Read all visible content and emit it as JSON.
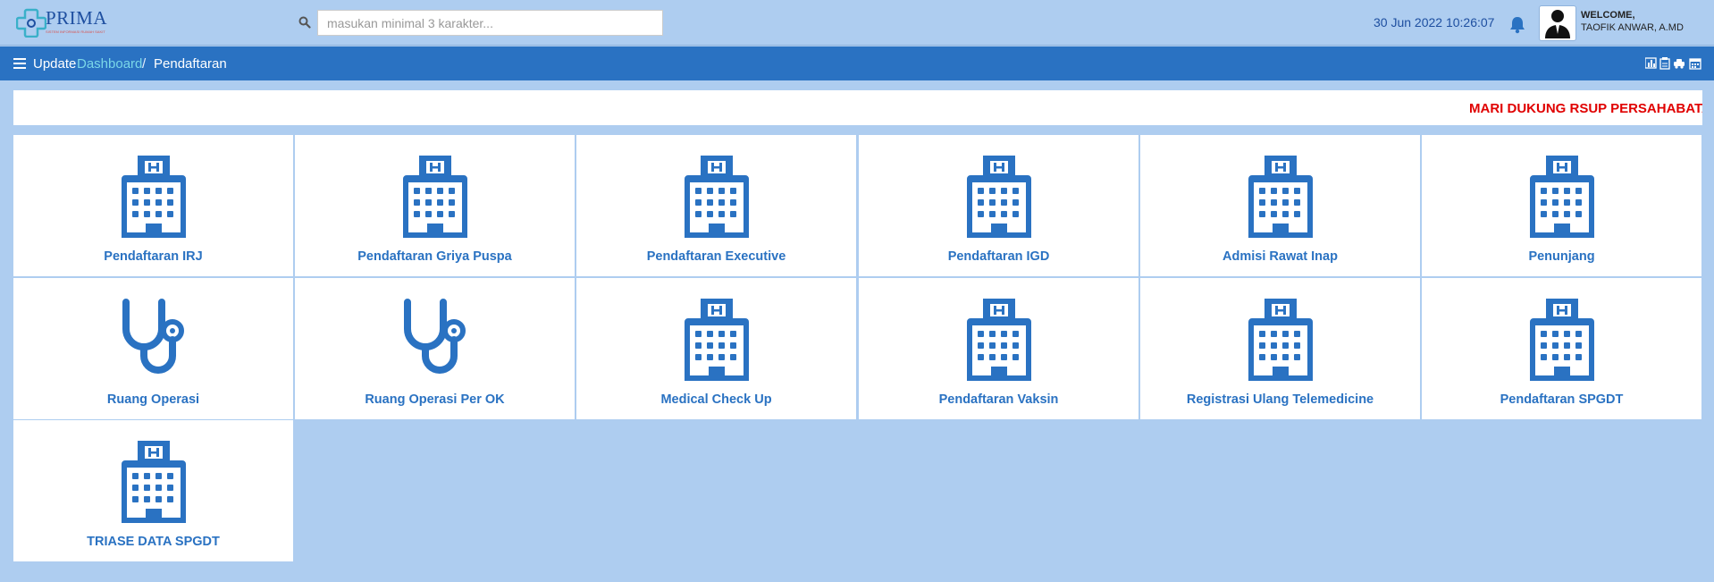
{
  "header": {
    "logo_name": "PRIMA",
    "logo_tagline": "SISTEM INFORMASI RUMAH SAKIT",
    "search_placeholder": "masukan minimal 3 karakter...",
    "datetime": "30 Jun 2022 10:26:07",
    "welcome": "WELCOME,",
    "username": "TAOFIK ANWAR, A.MD"
  },
  "breadcrumb": {
    "update": "Update",
    "dashboard": "Dashboard",
    "separator": "/",
    "current": "Pendaftaran"
  },
  "marquee": {
    "text": "MARI DUKUNG RSUP PERSAHABATAN"
  },
  "colors": {
    "accent": "#2a72c2",
    "background": "#aecdf0",
    "marquee": "#e00000"
  },
  "tiles": [
    {
      "label": "Pendaftaran IRJ",
      "icon": "hospital-icon"
    },
    {
      "label": "Pendaftaran Griya Puspa",
      "icon": "hospital-icon"
    },
    {
      "label": "Pendaftaran Executive",
      "icon": "hospital-icon"
    },
    {
      "label": "Pendaftaran IGD",
      "icon": "hospital-icon"
    },
    {
      "label": "Admisi Rawat Inap",
      "icon": "hospital-icon"
    },
    {
      "label": "Penunjang",
      "icon": "hospital-icon"
    },
    {
      "label": "Ruang Operasi",
      "icon": "stethoscope-icon"
    },
    {
      "label": "Ruang Operasi Per OK",
      "icon": "stethoscope-icon"
    },
    {
      "label": "Medical Check Up",
      "icon": "hospital-icon"
    },
    {
      "label": "Pendaftaran Vaksin",
      "icon": "hospital-icon"
    },
    {
      "label": "Registrasi Ulang Telemedicine",
      "icon": "hospital-icon"
    },
    {
      "label": "Pendaftaran SPGDT",
      "icon": "hospital-icon"
    },
    {
      "label": "TRIASE DATA SPGDT",
      "icon": "hospital-icon"
    }
  ]
}
